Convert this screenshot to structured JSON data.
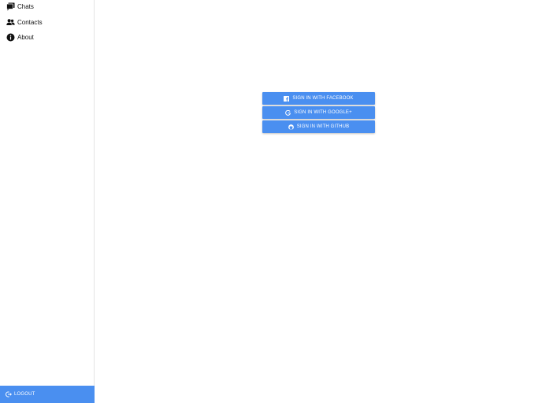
{
  "sidebar": {
    "items": [
      {
        "label": "Chats",
        "icon": "chats-icon"
      },
      {
        "label": "Contacts",
        "icon": "contacts-icon"
      },
      {
        "label": "About",
        "icon": "info-icon"
      }
    ],
    "logout_label": "LOGOUT",
    "logout_icon": "logout-icon"
  },
  "auth": {
    "facebook_label": "SIGN IN WITH FACEBOOK",
    "google_label": "SIGN IN WITH GOOGLE+",
    "github_label": "SIGN IN WITH GITHUB",
    "icons": [
      "facebook-icon",
      "google-icon",
      "github-icon"
    ]
  },
  "colors": {
    "accent": "#4a8ff0",
    "text": "#111111",
    "button_text": "#ffffff"
  }
}
